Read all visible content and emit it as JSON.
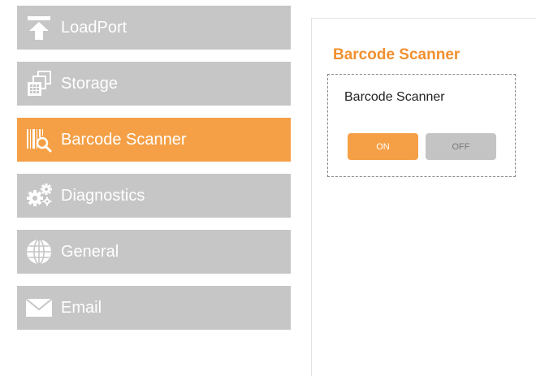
{
  "sidebar": {
    "items": [
      {
        "label": "LoadPort",
        "icon": "upload-arrow-icon",
        "active": false
      },
      {
        "label": "Storage",
        "icon": "storage-stack-icon",
        "active": false
      },
      {
        "label": "Barcode Scanner",
        "icon": "barcode-search-icon",
        "active": true
      },
      {
        "label": "Diagnostics",
        "icon": "gears-icon",
        "active": false
      },
      {
        "label": "General",
        "icon": "globe-icon",
        "active": false
      },
      {
        "label": "Email",
        "icon": "envelope-icon",
        "active": false
      }
    ]
  },
  "panel": {
    "title": "Barcode Scanner",
    "setting": {
      "label": "Barcode Scanner",
      "on_label": "ON",
      "off_label": "OFF",
      "selected": "ON"
    }
  },
  "colors": {
    "accent": "#f5a046",
    "title": "#f0902f",
    "inactive": "#c6c6c6"
  }
}
